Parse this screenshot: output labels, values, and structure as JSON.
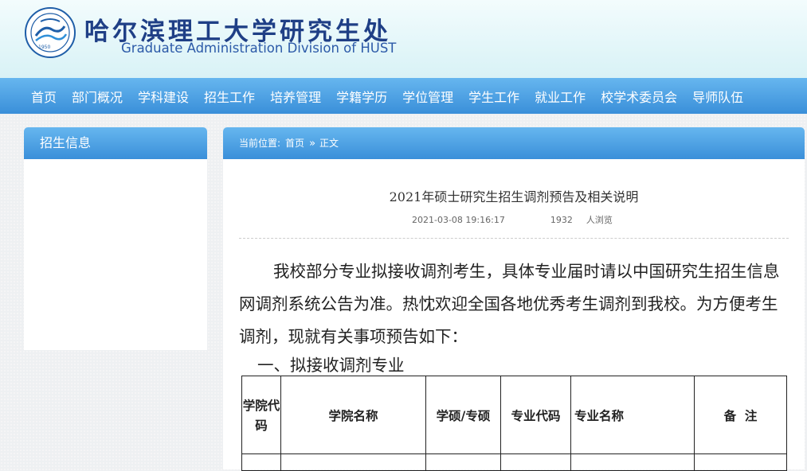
{
  "header": {
    "title_cn": "哈尔滨理工大学研究生处",
    "title_en": "Graduate Administration Division of HUST",
    "logo_year": "1950"
  },
  "nav": [
    "首页",
    "部门概况",
    "学科建设",
    "招生工作",
    "培养管理",
    "学籍学历",
    "学位管理",
    "学生工作",
    "就业工作",
    "校学术委员会",
    "导师队伍"
  ],
  "sidebar": {
    "title": "招生信息"
  },
  "breadcrumb": {
    "label": "当前位置:",
    "home": "首页",
    "sep": "»",
    "current": "正文"
  },
  "article": {
    "title": "2021年硕士研究生招生调剂预告及相关说明",
    "date": "2021-03-08 19:16:17",
    "views": "1932",
    "views_unit": "人浏览",
    "paragraph": "我校部分专业拟接收调剂考生，具体专业届时请以中国研究生招生信息网调剂系统公告为准。热忱欢迎全国各地优秀考生调剂到我校。为方便考生调剂，现就有关事项预告如下：",
    "section": "一、拟接收调剂专业"
  },
  "table": {
    "headers": [
      "学院代码",
      "学院名称",
      "学硕/专硕",
      "专业代码",
      "专业名称",
      "备  注"
    ]
  }
}
